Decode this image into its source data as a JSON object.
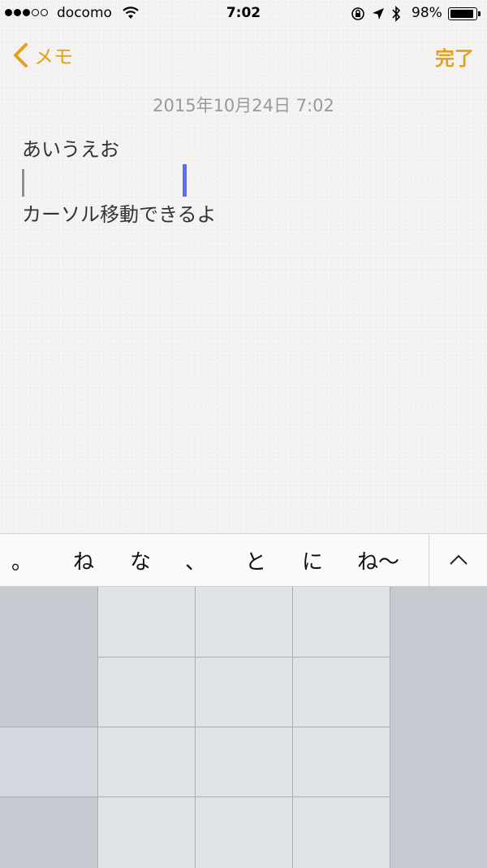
{
  "status_bar": {
    "carrier": "docomo",
    "time": "7:02",
    "battery_percent": "98%",
    "battery_level": 0.98,
    "signal_bars": 3,
    "signal_total": 5,
    "icons": [
      "wifi-icon",
      "orientation-lock-icon",
      "location-arrow-icon",
      "bluetooth-icon",
      "battery-icon"
    ]
  },
  "nav": {
    "back_label": "メモ",
    "done_label": "完了",
    "accent_color": "#e0a21b"
  },
  "note": {
    "date": "2015年10月24日 7:02",
    "lines": [
      "あいうえお",
      "",
      "カーソル移動できるよ"
    ]
  },
  "candidates": {
    "items": [
      "。",
      "ね",
      "な",
      "、",
      "と",
      "に",
      "ね〜"
    ],
    "expand_icon": "chevron-up-icon"
  },
  "keyboard": {
    "rows": 4,
    "columns": 5,
    "key_color": "#e0e3e6",
    "side_color": "#c6c9d0"
  }
}
